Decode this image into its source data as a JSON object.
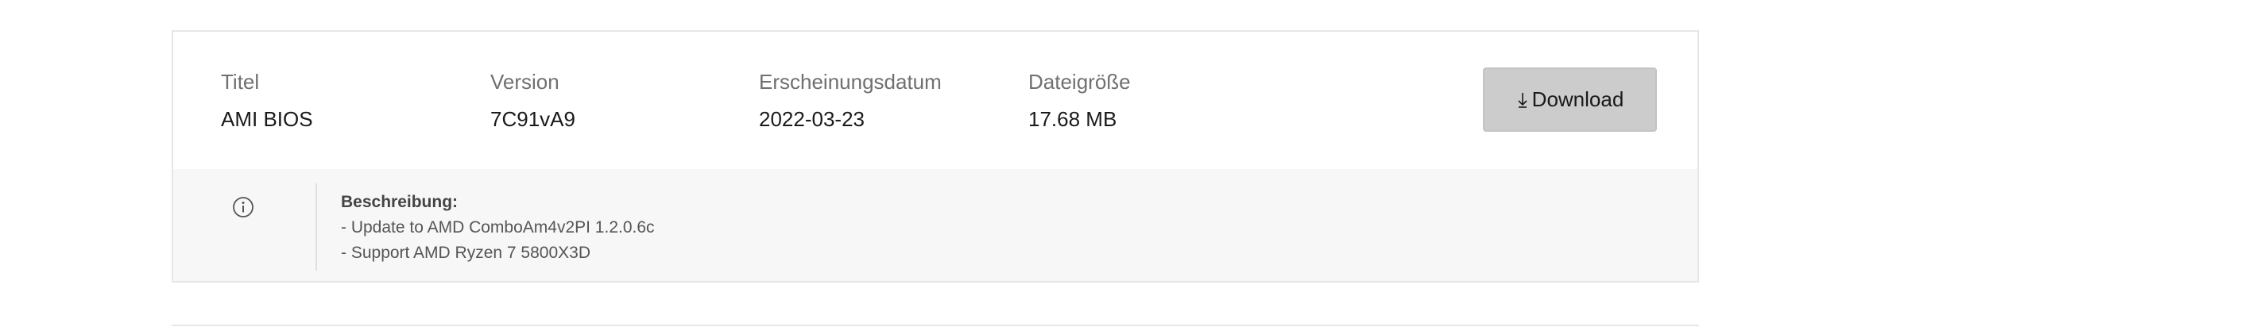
{
  "download_item": {
    "title": {
      "label": "Titel",
      "value": "AMI BIOS"
    },
    "version": {
      "label": "Version",
      "value": "7C91vA9"
    },
    "release_date": {
      "label": "Erscheinungsdatum",
      "value": "2022-03-23"
    },
    "file_size": {
      "label": "Dateigröße",
      "value": "17.68 MB"
    },
    "download_button": {
      "label": "Download",
      "icon": "download-arrow-icon"
    },
    "description": {
      "icon": "info-icon",
      "heading": "Beschreibung:",
      "lines": [
        "- Update to AMD ComboAm4v2PI 1.2.0.6c",
        "- Support AMD Ryzen 7 5800X3D"
      ]
    }
  }
}
